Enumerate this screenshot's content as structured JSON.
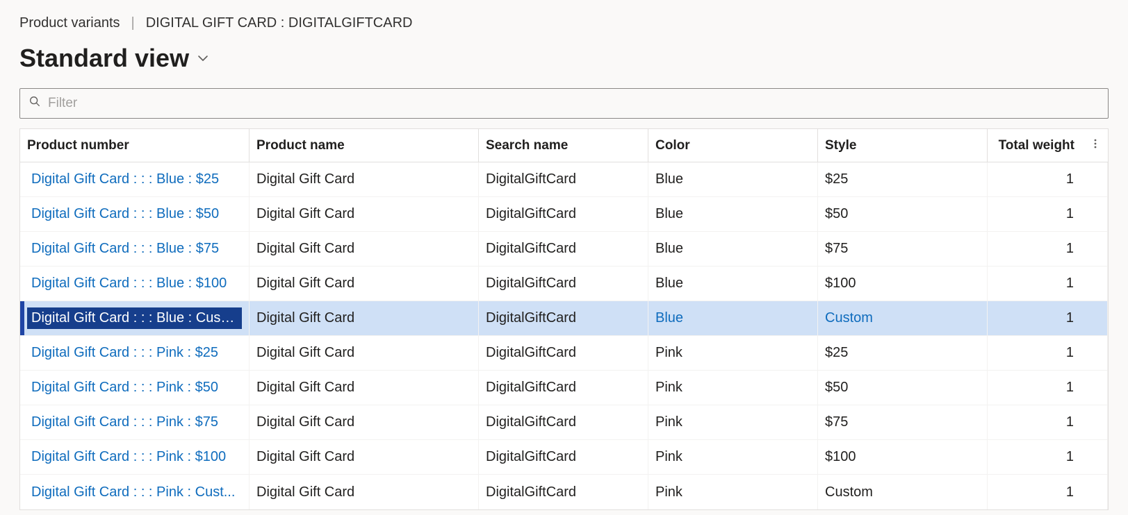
{
  "breadcrumb": {
    "section": "Product variants",
    "detail": "DIGITAL GIFT CARD : DIGITALGIFTCARD"
  },
  "view": {
    "title": "Standard view"
  },
  "filter": {
    "placeholder": "Filter"
  },
  "grid": {
    "columns": {
      "product_number": "Product number",
      "product_name": "Product name",
      "search_name": "Search name",
      "color": "Color",
      "style": "Style",
      "total_weight": "Total weight"
    },
    "selected_index": 4,
    "rows": [
      {
        "product_number": "Digital Gift Card :  :  : Blue : $25",
        "product_name": "Digital Gift Card",
        "search_name": "DigitalGiftCard",
        "color": "Blue",
        "style": "$25",
        "total_weight": "1"
      },
      {
        "product_number": "Digital Gift Card :  :  : Blue : $50",
        "product_name": "Digital Gift Card",
        "search_name": "DigitalGiftCard",
        "color": "Blue",
        "style": "$50",
        "total_weight": "1"
      },
      {
        "product_number": "Digital Gift Card :  :  : Blue : $75",
        "product_name": "Digital Gift Card",
        "search_name": "DigitalGiftCard",
        "color": "Blue",
        "style": "$75",
        "total_weight": "1"
      },
      {
        "product_number": "Digital Gift Card :  :  : Blue : $100",
        "product_name": "Digital Gift Card",
        "search_name": "DigitalGiftCard",
        "color": "Blue",
        "style": "$100",
        "total_weight": "1"
      },
      {
        "product_number": "Digital Gift Card :  :  : Blue : Custom",
        "product_name": "Digital Gift Card",
        "search_name": "DigitalGiftCard",
        "color": "Blue",
        "style": "Custom",
        "total_weight": "1"
      },
      {
        "product_number": "Digital Gift Card :  :  : Pink : $25",
        "product_name": "Digital Gift Card",
        "search_name": "DigitalGiftCard",
        "color": "Pink",
        "style": "$25",
        "total_weight": "1"
      },
      {
        "product_number": "Digital Gift Card :  :  : Pink : $50",
        "product_name": "Digital Gift Card",
        "search_name": "DigitalGiftCard",
        "color": "Pink",
        "style": "$50",
        "total_weight": "1"
      },
      {
        "product_number": "Digital Gift Card :  :  : Pink : $75",
        "product_name": "Digital Gift Card",
        "search_name": "DigitalGiftCard",
        "color": "Pink",
        "style": "$75",
        "total_weight": "1"
      },
      {
        "product_number": "Digital Gift Card :  :  : Pink : $100",
        "product_name": "Digital Gift Card",
        "search_name": "DigitalGiftCard",
        "color": "Pink",
        "style": "$100",
        "total_weight": "1"
      },
      {
        "product_number": "Digital Gift Card :  :  : Pink : Cust...",
        "product_name": "Digital Gift Card",
        "search_name": "DigitalGiftCard",
        "color": "Pink",
        "style": "Custom",
        "total_weight": "1"
      }
    ]
  }
}
